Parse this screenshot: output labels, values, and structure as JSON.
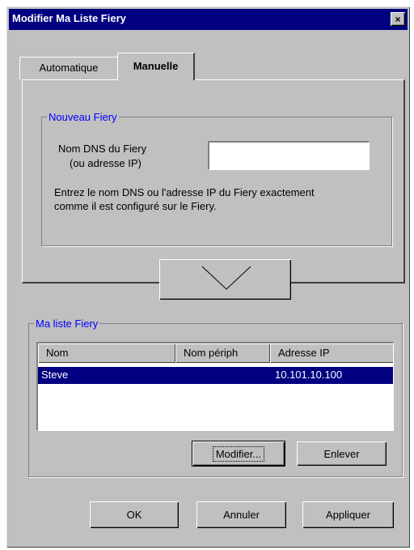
{
  "window": {
    "title": "Modifier Ma Liste Fiery",
    "close_icon": "×"
  },
  "tabs": [
    {
      "label": "Automatique",
      "selected": false
    },
    {
      "label": "Manuelle",
      "selected": true
    }
  ],
  "new_fiery": {
    "group_label": "Nouveau Fiery",
    "dns_label_line1": "Nom DNS du Fiery",
    "dns_label_line2": "(ou adresse IP)",
    "dns_value": "",
    "help_line1": "Entrez le nom DNS ou l'adresse IP du Fiery exactement",
    "help_line2": "comme il est configuré sur le Fiery."
  },
  "add_button_icon": "arrow-down-icon",
  "my_list": {
    "group_label": "Ma liste Fiery",
    "columns": [
      "Nom",
      "Nom périph",
      "Adresse IP"
    ],
    "rows": [
      {
        "name": "Steve",
        "device": "",
        "ip": "10.101.10.100",
        "selected": true
      }
    ],
    "modify_label": "Modifier...",
    "remove_label": "Enlever"
  },
  "footer": {
    "ok_label": "OK",
    "cancel_label": "Annuler",
    "apply_label": "Appliquer"
  },
  "colors": {
    "titlebar": "#000080",
    "selection": "#000080",
    "group_label": "#0000ff",
    "face": "#c0c0c0"
  }
}
